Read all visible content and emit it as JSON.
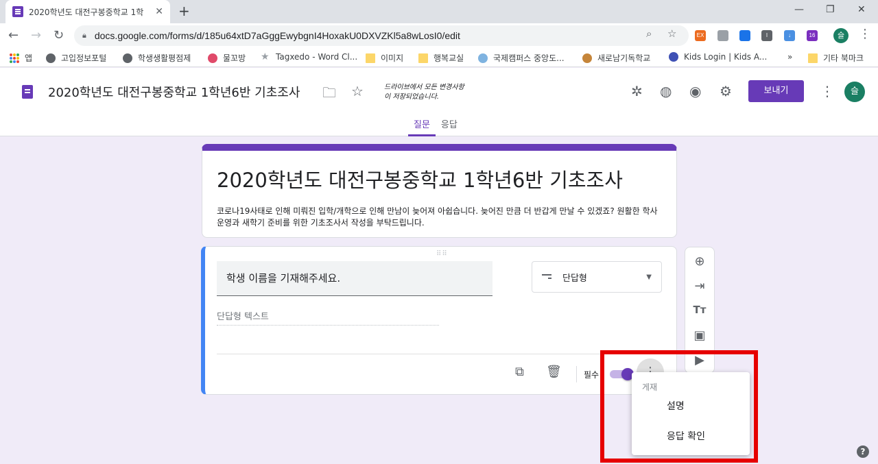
{
  "browser": {
    "tab_title": "2020학년도 대전구봉중학교 1학",
    "url": "docs.google.com/forms/d/185u64xtD7aGggEwybgnI4HoxakU0DXVZKl5a8wLosI0/edit",
    "ext_badge": "16",
    "profile_initial": "슬",
    "bookmarks": [
      "앱",
      "고입정보포털",
      "학생생활평점제",
      "물꼬방",
      "Tagxedo - Word Cl...",
      "이미지",
      "행복교실",
      "국제캠퍼스 중앙도...",
      "새로남기독학교",
      "Kids Login | Kids A...",
      "»",
      "기타 북마크"
    ]
  },
  "header": {
    "doc_title": "2020학년도 대전구봉중학교 1학년6반 기초조사",
    "saved_line1": "드라이브에서 모든 변경사항",
    "saved_line2": "이 저장되었습니다.",
    "send_label": "보내기",
    "avatar_initial": "슬",
    "tabs": [
      "질문",
      "응답"
    ]
  },
  "form": {
    "title": "2020학년도 대전구봉중학교 1학년6반 기초조사",
    "description": "코로나19사태로 인해 미뤄진 입학/개학으로 인해 만남이 늦어져 아쉽습니다. 늦어진 만큼 더 반갑게 만날 수 있겠죠? 원활한 학사운영과 새학기 준비를 위한 기초조사서 작성을 부탁드립니다."
  },
  "question": {
    "title": "학생 이름을 기재해주세요.",
    "type": "단답형",
    "answer_hint": "단답형 텍스트",
    "required_label": "필수",
    "required_on": true
  },
  "menu": {
    "header": "게재",
    "items": [
      "설명",
      "응답 확인"
    ]
  },
  "help": "?",
  "colors": {
    "accent": "#673ab7",
    "highlight": "#e60000",
    "question_bar": "#4285f4"
  }
}
